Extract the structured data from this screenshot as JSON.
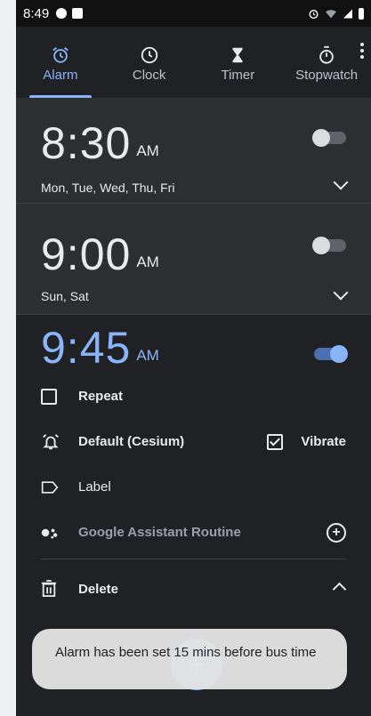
{
  "status_bar": {
    "time": "8:49"
  },
  "tabs": [
    {
      "label": "Alarm",
      "icon": "alarm-icon",
      "active": true
    },
    {
      "label": "Clock",
      "icon": "clock-icon",
      "active": false
    },
    {
      "label": "Timer",
      "icon": "hourglass-icon",
      "active": false
    },
    {
      "label": "Stopwatch",
      "icon": "stopwatch-icon",
      "active": false
    }
  ],
  "alarms": [
    {
      "time": "8:30",
      "ampm": "AM",
      "days": "Mon, Tue, Wed, Thu, Fri",
      "enabled": false
    },
    {
      "time": "9:00",
      "ampm": "AM",
      "days": "Sun, Sat",
      "enabled": false
    }
  ],
  "expanded_alarm": {
    "time": "9:45",
    "ampm": "AM",
    "enabled": true,
    "repeat_label": "Repeat",
    "ringtone_label": "Default (Cesium)",
    "vibrate_label": "Vibrate",
    "vibrate_checked": true,
    "label_label": "Label",
    "assistant_label": "Google Assistant Routine",
    "delete_label": "Delete"
  },
  "toast": {
    "message": "Alarm has been set 15 mins before bus time"
  },
  "colors": {
    "accent": "#8ab4f8",
    "background": "#202124",
    "card": "#2d2e31"
  }
}
